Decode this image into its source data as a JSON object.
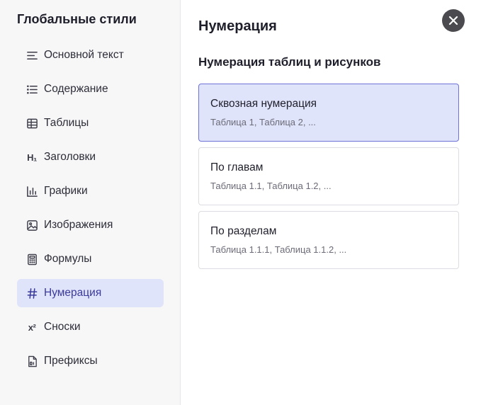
{
  "sidebar": {
    "title": "Глобальные стили",
    "items": [
      {
        "label": "Основной текст",
        "icon": "text-lines-icon"
      },
      {
        "label": "Содержание",
        "icon": "list-icon"
      },
      {
        "label": "Таблицы",
        "icon": "table-icon"
      },
      {
        "label": "Заголовки",
        "icon": "heading-icon",
        "glyph": "H₁"
      },
      {
        "label": "Графики",
        "icon": "bar-chart-icon"
      },
      {
        "label": "Изображения",
        "icon": "image-icon"
      },
      {
        "label": "Формулы",
        "icon": "calculator-icon"
      },
      {
        "label": "Нумерация",
        "icon": "hash-icon",
        "active": true
      },
      {
        "label": "Сноски",
        "icon": "superscript-icon",
        "glyph": "x²"
      },
      {
        "label": "Префиксы",
        "icon": "prefix-file-icon"
      }
    ]
  },
  "main": {
    "title": "Нумерация",
    "section_title": "Нумерация таблиц и рисунков",
    "options": [
      {
        "title": "Сквозная нумерация",
        "subtitle": "Таблица 1, Таблица 2, ...",
        "selected": true
      },
      {
        "title": "По главам",
        "subtitle": "Таблица 1.1, Таблица 1.2, ..."
      },
      {
        "title": "По разделам",
        "subtitle": "Таблица 1.1.1, Таблица 1.1.2, ..."
      }
    ]
  },
  "close_icon": "close-icon",
  "colors": {
    "accent": "#3a3a9a",
    "selected_bg": "#e0e4fb",
    "selected_border": "#6f72d6",
    "close_bg": "#4a4a4f"
  }
}
